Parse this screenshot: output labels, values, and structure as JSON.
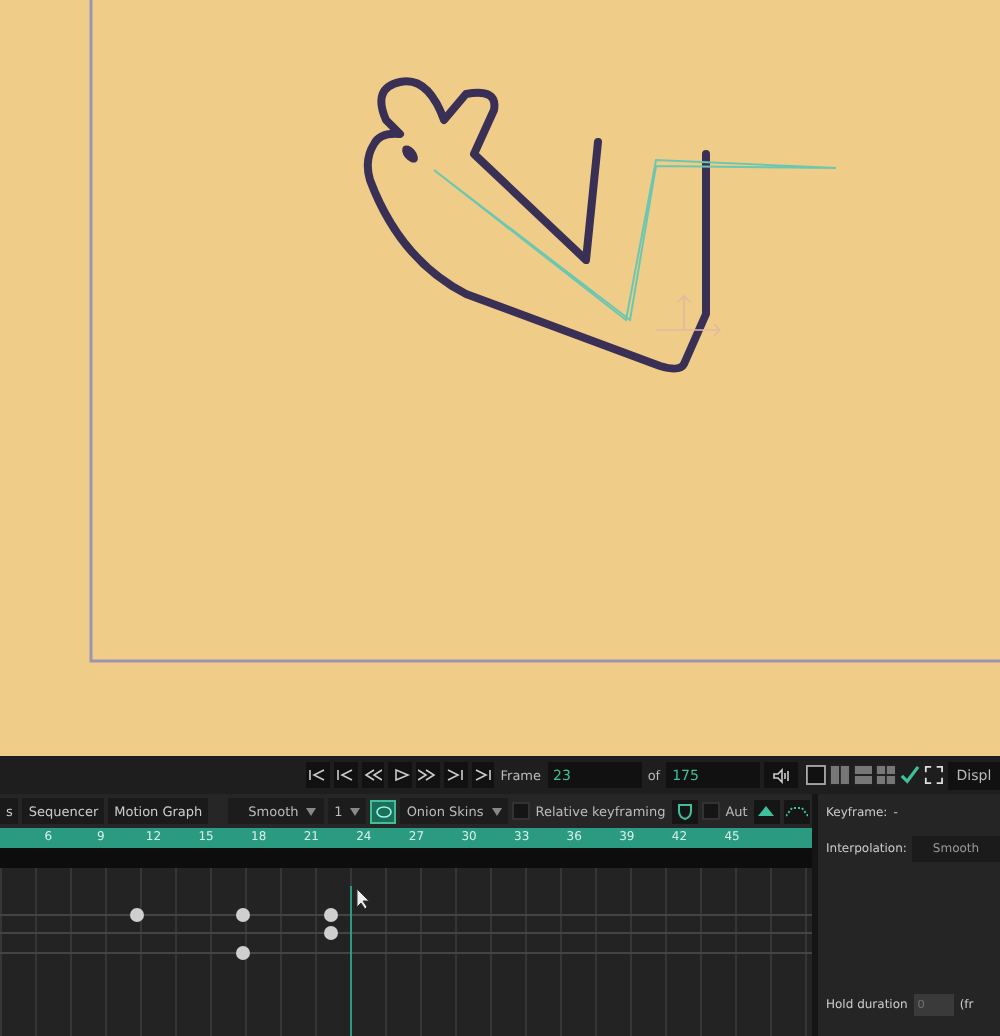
{
  "transport": {
    "frame_label": "Frame",
    "frame": "23",
    "of_label": "of",
    "total": "175"
  },
  "display_button": "Displ",
  "tabs": [
    {
      "label": "s"
    },
    {
      "label": "Sequencer"
    },
    {
      "label": "Motion Graph"
    }
  ],
  "interpolation_dropdown": "Smooth",
  "onion": {
    "count": "1",
    "on": true,
    "label": "Onion Skins"
  },
  "relative_keyframing": {
    "label": "Relative keyframing",
    "checked": false
  },
  "auto": {
    "label": "Aut",
    "checked": false
  },
  "ruler": [
    "6",
    "9",
    "12",
    "15",
    "18",
    "21",
    "24",
    "27",
    "30",
    "33",
    "36",
    "39",
    "42",
    "45"
  ],
  "panel": {
    "keyframe_label": "Keyframe:",
    "keyframe_value": "-",
    "interpolation_label": "Interpolation:",
    "interpolation_value": "Smooth",
    "hold_label": "Hold duration",
    "hold_placeholder": "0",
    "hold_unit": "(fr"
  }
}
